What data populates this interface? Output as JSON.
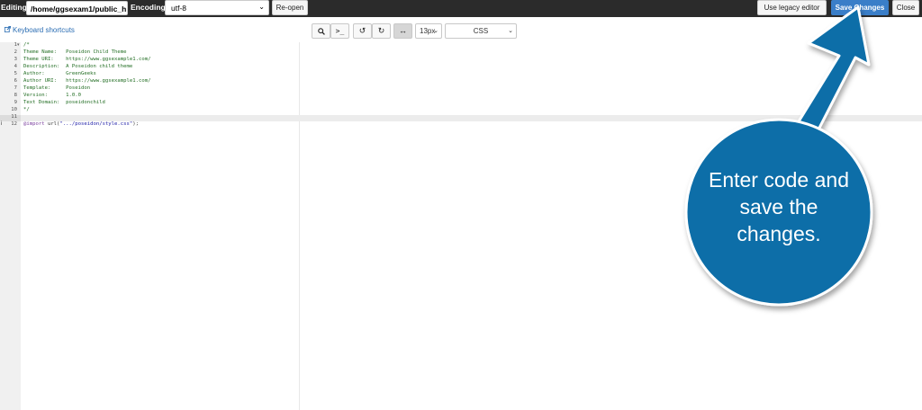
{
  "topbar": {
    "editing_label": "Editing:",
    "path_value": "/home/ggsexam1/public_h",
    "encoding_label": "Encoding:",
    "encoding_value": "utf-8",
    "reopen_label": "Re-open",
    "legacy_label": "Use legacy editor",
    "save_label": "Save Changes",
    "close_label": "Close"
  },
  "toolbar": {
    "keyboard_shortcuts": "Keyboard shortcuts",
    "font_size": "13px",
    "mode": "CSS"
  },
  "editor": {
    "lines": [
      {
        "n": "1",
        "text": "/*"
      },
      {
        "n": "2",
        "text": "Theme Name:   Poseidon Child Theme"
      },
      {
        "n": "3",
        "text": "Theme URI:    https://www.ggsexample1.com/"
      },
      {
        "n": "4",
        "text": "Description:  A Poseidon child theme"
      },
      {
        "n": "5",
        "text": "Author:       GreenGeeks"
      },
      {
        "n": "6",
        "text": "Author URI:   https://www.ggsexample1.com/"
      },
      {
        "n": "7",
        "text": "Template:     Poseidon"
      },
      {
        "n": "8",
        "text": "Version:      1.0.0"
      },
      {
        "n": "9",
        "text": "Text Domain:  poseidonchild"
      },
      {
        "n": "10",
        "text": "*/"
      },
      {
        "n": "11",
        "text": ""
      },
      {
        "n": "12",
        "keyword": "@import",
        "plain": " url(",
        "string": "\".../poseidon/style.css\"",
        "end": ");"
      }
    ]
  },
  "callout": {
    "line1": "Enter code and",
    "line2": "save the",
    "line3": "changes.",
    "color": "#0a6ea8"
  },
  "colors": {
    "topbar_bg": "#2b2b2b",
    "save_button": "#3a7ec8",
    "comment_text": "#236e24"
  }
}
